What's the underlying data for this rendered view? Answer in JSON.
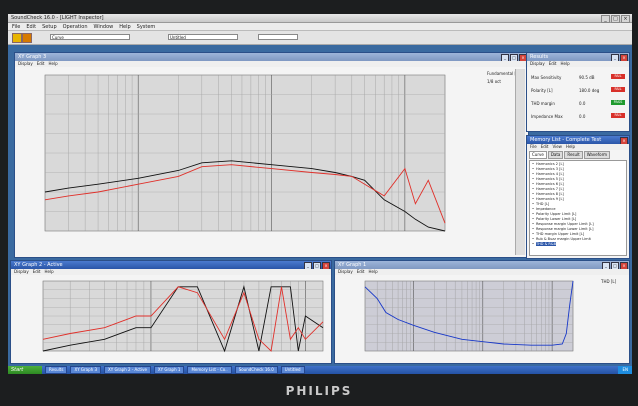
{
  "app": {
    "title": "SoundCheck 16.0 - [LIGHT Inspector]"
  },
  "menubar": [
    "File",
    "Edit",
    "Setup",
    "Operation",
    "Window",
    "Help",
    "System"
  ],
  "toolbar": {
    "field1": "Curve",
    "field2": "Untitled"
  },
  "xy_graph_main": {
    "title": "XY Graph 3",
    "menu": [
      "Display",
      "Edit",
      "Help"
    ],
    "legend_title": "Fundamental [L]",
    "legend_value": "1/8 oct"
  },
  "xy_graph_bottom_left": {
    "title": "XY Graph 2 - Active",
    "menu": [
      "Display",
      "Edit",
      "Help"
    ]
  },
  "xy_graph_bottom_right": {
    "title": "XY Graph 1",
    "menu": [
      "Display",
      "Edit",
      "Help"
    ],
    "legend_title": "THD [L]"
  },
  "results": {
    "title": "Results",
    "menu": [
      "Display",
      "Edit",
      "Help"
    ],
    "rows": [
      {
        "label": "Max Sensitivity",
        "value": "90.5 dB",
        "status": "FAIL",
        "color": "#d8302a"
      },
      {
        "label": "Polarity [L]",
        "value": "180.0 deg",
        "status": "FAIL",
        "color": "#d8302a"
      },
      {
        "label": "THD margin",
        "value": "0.0",
        "status": "PASS",
        "color": "#1f9a2e"
      },
      {
        "label": "Impedance Max",
        "value": "0.0",
        "status": "FAIL",
        "color": "#d8302a"
      }
    ]
  },
  "memory_list": {
    "title": "Memory List - Complete Test",
    "menu": [
      "File",
      "Edit",
      "View",
      "Help"
    ],
    "tabs": [
      "Curve",
      "Data",
      "Result",
      "Waveform"
    ],
    "items": [
      "Harmonics 2 [L]",
      "Harmonics 3 [L]",
      "Harmonics 4 [L]",
      "Harmonics 5 [L]",
      "Harmonics 6 [L]",
      "Harmonics 7 [L]",
      "Harmonics 8 [L]",
      "Harmonics 9 [L]",
      "THD [L]",
      "Impedance",
      "Polarity Upper Limit [L]",
      "Polarity Lower Limit [L]",
      "Response margin Upper Limit [L]",
      "Response margin Lower Limit [L]",
      "THD margin Upper Limit [L]",
      "Rub & Buzz margin Upper Limit",
      "THD & R&B"
    ]
  },
  "taskbar": {
    "start": "Start",
    "tasks": [
      "Results",
      "XY Graph 3",
      "XY Graph 2 - Active",
      "XY Graph 1",
      "Memory List - Co..",
      "SoundCheck 16.0",
      "Untitled"
    ],
    "tray": "EN"
  },
  "monitor_brand": "PHILIPS",
  "chart_data": [
    {
      "type": "line",
      "x": [
        20,
        30,
        50,
        100,
        200,
        300,
        500,
        1000,
        2000,
        3000,
        4000,
        5000,
        7000,
        10000,
        12000,
        15000,
        20000
      ],
      "series": [
        {
          "color": "#111111",
          "values": [
            80,
            81,
            82,
            83.5,
            85.5,
            87.5,
            88,
            87,
            86,
            85,
            84,
            83,
            78,
            75,
            73,
            71,
            70
          ]
        },
        {
          "color": "#e0302a",
          "values": [
            78,
            79,
            80,
            82,
            84,
            86.5,
            87,
            86,
            85,
            84.5,
            84,
            82,
            79,
            86,
            77,
            83,
            72
          ]
        }
      ],
      "xlim": [
        20,
        20000
      ],
      "ylim": [
        70,
        110
      ],
      "xscale": "log",
      "grid": true
    },
    {
      "type": "line",
      "x": [
        20,
        30,
        50,
        80,
        100,
        150,
        200,
        300,
        400,
        500,
        600,
        700,
        800,
        900,
        1000,
        1300
      ],
      "series": [
        {
          "color": "#111111",
          "values": [
            -60,
            -55,
            -50,
            -40,
            -40,
            -5,
            -5,
            -60,
            -5,
            -60,
            -5,
            -5,
            -5,
            -60,
            -30,
            -40
          ]
        },
        {
          "color": "#e0302a",
          "values": [
            -50,
            -45,
            -40,
            -30,
            -30,
            -5,
            -10,
            -50,
            -10,
            -50,
            -60,
            -5,
            -50,
            -40,
            -50,
            -35
          ]
        }
      ],
      "xlim": [
        20,
        1300
      ],
      "ylim": [
        -60,
        0
      ],
      "xscale": "log",
      "grid": true
    },
    {
      "type": "line",
      "x": [
        20,
        30,
        40,
        60,
        100,
        200,
        500,
        1000,
        2000,
        5000,
        10000,
        14000,
        16000,
        18000,
        20000
      ],
      "series": [
        {
          "name": "THD [L]",
          "color": "#1838c8",
          "values": [
            55,
            45,
            33,
            27,
            22,
            16,
            10,
            8,
            6,
            5,
            5,
            6,
            15,
            40,
            60
          ]
        }
      ],
      "xlim": [
        20,
        20000
      ],
      "ylim": [
        0,
        60
      ],
      "xscale": "log",
      "grid": true
    }
  ]
}
